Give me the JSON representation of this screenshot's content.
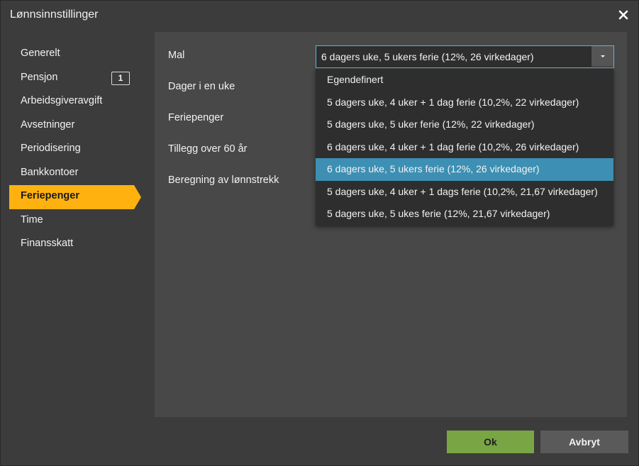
{
  "window": {
    "title": "Lønnsinnstillinger"
  },
  "sidebar": {
    "items": [
      {
        "label": "Generelt"
      },
      {
        "label": "Pensjon",
        "badge": "1"
      },
      {
        "label": "Arbeidsgiveravgift"
      },
      {
        "label": "Avsetninger"
      },
      {
        "label": "Periodisering"
      },
      {
        "label": "Bankkontoer"
      },
      {
        "label": "Feriepenger",
        "active": true
      },
      {
        "label": "Time"
      },
      {
        "label": "Finansskatt"
      }
    ],
    "active_color": "#ffb20f"
  },
  "form": {
    "labels": {
      "mal": "Mal",
      "dager": "Dager i en uke",
      "feriepenger": "Feriepenger",
      "tillegg": "Tillegg over 60 år",
      "beregning": "Beregning av lønnstrekk"
    },
    "mal_select": {
      "value": "6 dagers uke, 5 ukers ferie (12%, 26 virkedager)",
      "options": [
        "Egendefinert",
        "5 dagers uke, 4 uker + 1 dag ferie (10,2%, 22 virkedager)",
        "5 dagers uke, 5 uker ferie (12%, 22 virkedager)",
        "6 dagers uke, 4 uker + 1 dag ferie (10,2%, 26 virkedager)",
        "6 dagers uke, 5 ukers ferie (12%, 26 virkedager)",
        "5 dagers uke, 4 uker + 1 dags ferie (10,2%, 21,67 virkedager)",
        "5 dagers uke, 5 ukes ferie (12%, 21,67 virkedager)"
      ],
      "selected_index": 4,
      "highlight_color": "#3d8fb3"
    }
  },
  "footer": {
    "ok_label": "Ok",
    "cancel_label": "Avbryt",
    "ok_color": "#79a545"
  }
}
